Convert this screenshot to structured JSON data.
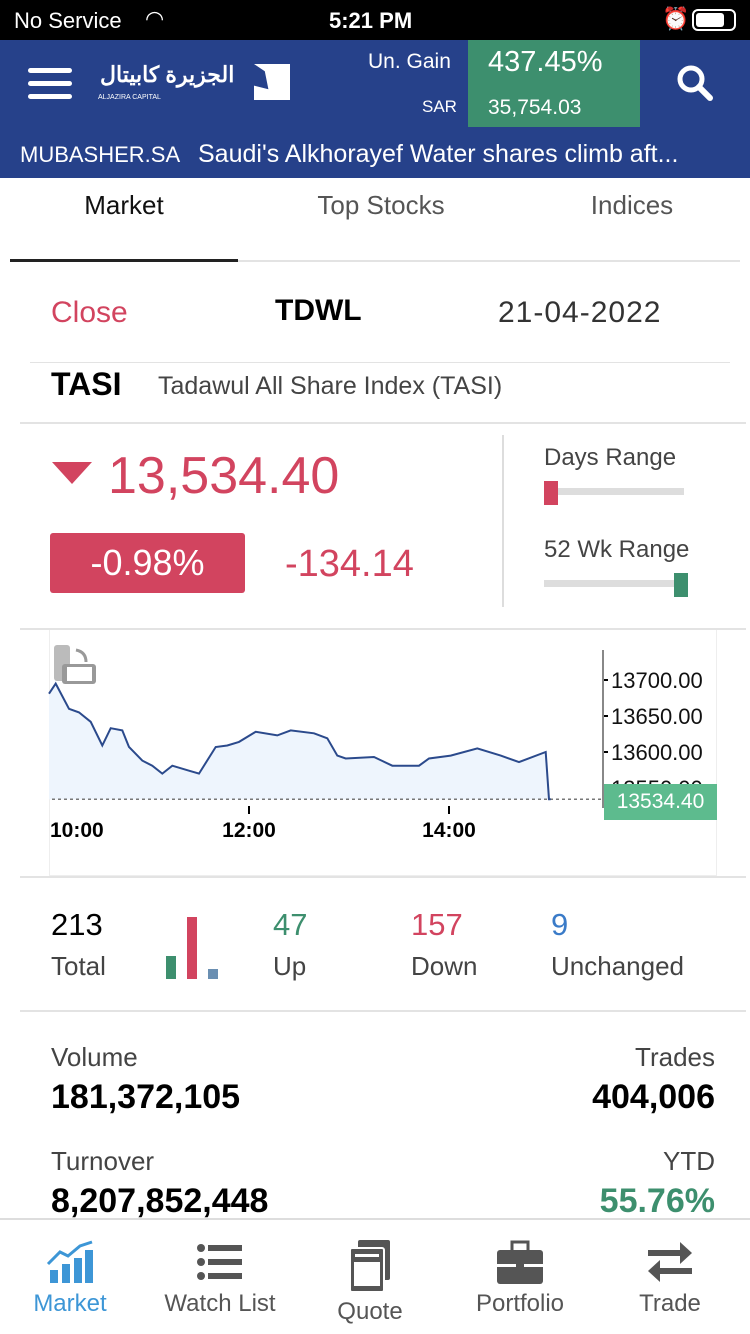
{
  "status_bar": {
    "carrier": "No Service",
    "time": "5:21 PM"
  },
  "header": {
    "logo_text": "الجزيرة كابيتال",
    "logo_sub": "ALJAZIRA CAPITAL الجزيرة للأسواق المالية",
    "gain_label": "Un. Gain",
    "gain_value": "437.45%",
    "currency_label": "SAR",
    "currency_value": "35,754.03",
    "news_source": "MUBASHER.SA",
    "news_headline": "Saudi's Alkhorayef Water shares climb aft..."
  },
  "tabs": [
    {
      "label": "Market",
      "active": true
    },
    {
      "label": "Top Stocks"
    },
    {
      "label": "Indices"
    }
  ],
  "market": {
    "status": "Close",
    "exchange": "TDWL",
    "date": "21-04-2022",
    "symbol": "TASI",
    "name": "Tadawul All Share Index (TASI)",
    "price": "13,534.40",
    "change_pct": "-0.98%",
    "change": "-134.14",
    "days_range_label": "Days Range",
    "days_range_position": 0,
    "wk52_label": "52 Wk Range",
    "wk52_position": 1
  },
  "chart_data": {
    "type": "line",
    "x_ticks": [
      "10:00",
      "12:00",
      "14:00"
    ],
    "y_ticks": [
      "13700.00",
      "13650.00",
      "13600.00",
      "13550.00"
    ],
    "last_value_label": "13534.40",
    "last_value": 13534.4,
    "ylim": [
      13520,
      13715
    ],
    "x": [
      "10:00",
      "10:04",
      "10:12",
      "10:18",
      "10:25",
      "10:32",
      "10:37",
      "10:44",
      "10:48",
      "10:56",
      "11:02",
      "11:08",
      "11:14",
      "11:24",
      "11:30",
      "11:40",
      "11:47",
      "11:54",
      "12:04",
      "12:17",
      "12:25",
      "12:39",
      "12:47",
      "12:53",
      "12:58",
      "13:15",
      "13:26",
      "13:42",
      "13:48",
      "14:01",
      "14:17",
      "14:31",
      "14:42",
      "14:58",
      "15:00",
      "15:01"
    ],
    "values": [
      13681,
      13695,
      13660,
      13655,
      13642,
      13609,
      13633,
      13630,
      13607,
      13588,
      13581,
      13570,
      13581,
      13574,
      13570,
      13607,
      13609,
      13614,
      13628,
      13623,
      13630,
      13626,
      13619,
      13595,
      13591,
      13593,
      13581,
      13581,
      13591,
      13595,
      13605,
      13595,
      13586,
      13600,
      13534.4,
      13534.4
    ],
    "colors": {
      "line": "#2b4a8c",
      "fill": "#eef5fd",
      "last_label": "#5dbb8e"
    }
  },
  "breadth": {
    "total": "213",
    "total_label": "Total",
    "up": "47",
    "up_label": "Up",
    "down": "157",
    "down_label": "Down",
    "unchanged": "9",
    "unchanged_label": "Unchanged"
  },
  "stats": {
    "volume_label": "Volume",
    "volume": "181,372,105",
    "trades_label": "Trades",
    "trades": "404,006",
    "turnover_label": "Turnover",
    "turnover": "8,207,852,448",
    "ytd_label": "YTD",
    "ytd": "55.76%"
  },
  "bottom_nav": [
    {
      "label": "Market",
      "icon": "market-chart-icon",
      "active": true
    },
    {
      "label": "Watch List",
      "icon": "list-icon"
    },
    {
      "label": "Quote",
      "icon": "quote-icon"
    },
    {
      "label": "Portfolio",
      "icon": "briefcase-icon"
    },
    {
      "label": "Trade",
      "icon": "swap-arrows-icon"
    }
  ]
}
